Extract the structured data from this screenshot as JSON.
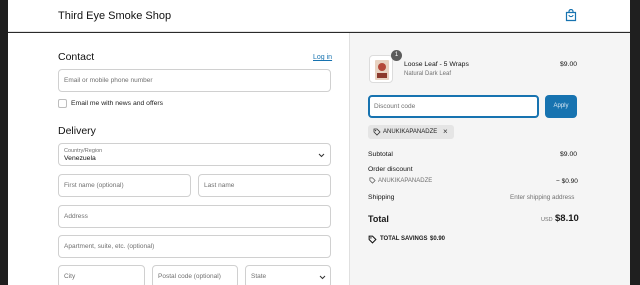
{
  "header": {
    "shop_name": "Third Eye Smoke Shop",
    "cart_icon": "shopping-bag-icon"
  },
  "contact": {
    "title": "Contact",
    "login_link": "Log in",
    "email_placeholder": "Email or mobile phone number",
    "newsletter_label": "Email me with news and offers"
  },
  "delivery": {
    "title": "Delivery",
    "country_label": "Country/Region",
    "country_value": "Venezuela",
    "first_name_placeholder": "First name (optional)",
    "last_name_placeholder": "Last name",
    "address_placeholder": "Address",
    "apartment_placeholder": "Apartment, suite, etc. (optional)",
    "city_placeholder": "City",
    "postal_placeholder": "Postal code (optional)",
    "state_placeholder": "State"
  },
  "order": {
    "item": {
      "name": "Loose Leaf - 5 Wraps",
      "variant": "Natural Dark Leaf",
      "price": "$9.00",
      "quantity": "1"
    },
    "discount_placeholder": "Discount code",
    "apply_label": "Apply",
    "applied_code": "ANUKIKAPANADZE",
    "subtotal_label": "Subtotal",
    "subtotal_value": "$9.00",
    "order_discount_label": "Order discount",
    "order_discount_code": "ANUKIKAPANADZE",
    "order_discount_value": "− $0.90",
    "shipping_label": "Shipping",
    "shipping_value": "Enter shipping address",
    "total_label": "Total",
    "currency": "USD",
    "total_value": "$8.10",
    "savings_label": "TOTAL SAVINGS",
    "savings_value": "$0.90"
  },
  "colors": {
    "accent": "#1773b0",
    "summary_bg": "#f5f5f5"
  }
}
